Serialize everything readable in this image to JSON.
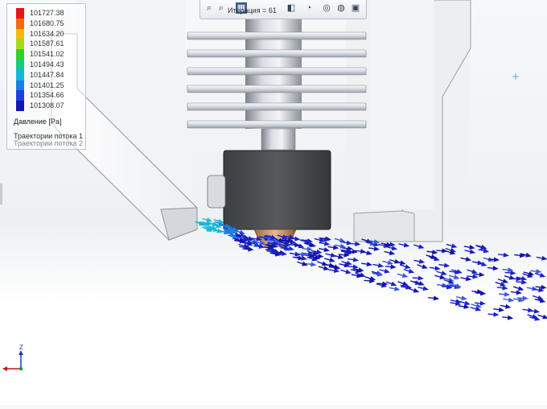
{
  "legend": {
    "values": [
      "101727.38",
      "101680.75",
      "101634.20",
      "101587.61",
      "101541.02",
      "101494.43",
      "101447.84",
      "101401.25",
      "101354.66",
      "101308.07"
    ],
    "colors": [
      "#e8141a",
      "#f06a12",
      "#f5b80f",
      "#a8d81a",
      "#2fd12a",
      "#15c98a",
      "#16b6d8",
      "#1a7ee6",
      "#1f3fe0",
      "#1414b8"
    ],
    "title": "Давление [Pa]",
    "trajectory_1": "Траектории потока 1",
    "trajectory_2": "Траектории потока 2"
  },
  "toolbar": {
    "caption": "Итерация = 61",
    "icons": [
      "zoom-icon",
      "zoom-area-icon",
      "section-view-icon",
      "view-orientation-icon",
      "display-style-icon",
      "hide-show-icon",
      "appearance-icon",
      "scene-icon",
      "render-icon"
    ]
  },
  "triad": {
    "z_label": "Z"
  },
  "colors": {
    "flow_arrow": "#1a22c8",
    "part_gray": "#e2e4e8",
    "nozzle_block": "#4a4c50"
  }
}
